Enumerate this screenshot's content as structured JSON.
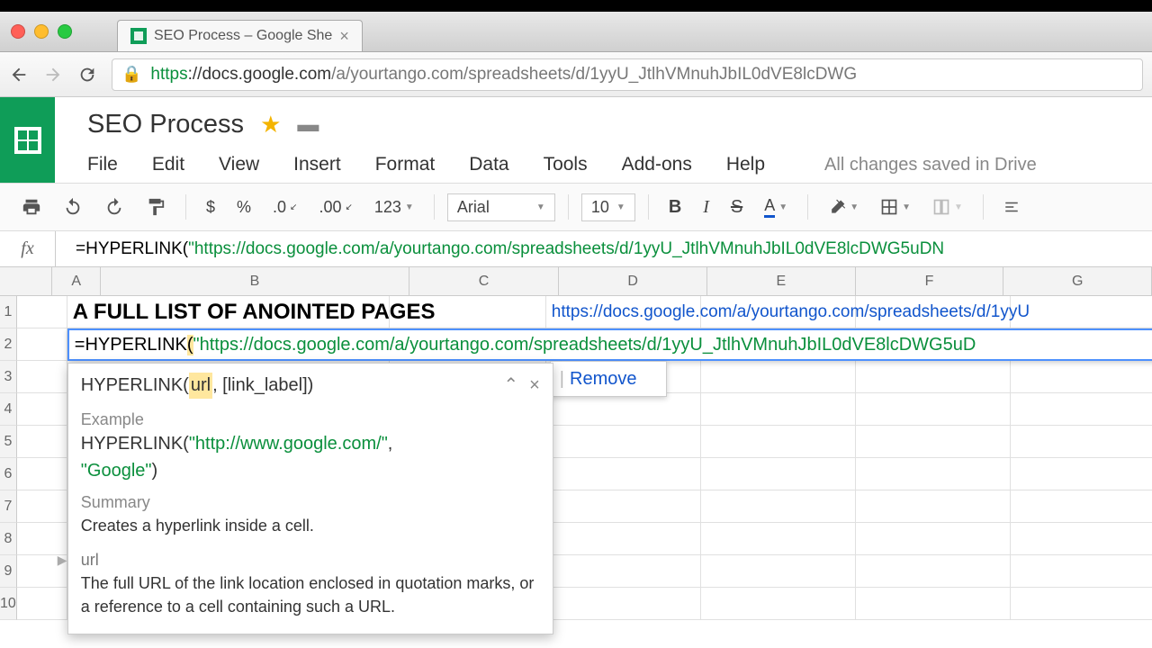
{
  "browser": {
    "tab_title": "SEO Process – Google She",
    "url_protocol": "https",
    "url_host": "://docs.google.com",
    "url_path": "/a/yourtango.com/spreadsheets/d/1yyU_JtlhVMnuhJbIL0dVE8lcDWG"
  },
  "doc": {
    "title": "SEO Process",
    "save_status": "All changes saved in Drive"
  },
  "menus": [
    "File",
    "Edit",
    "View",
    "Insert",
    "Format",
    "Data",
    "Tools",
    "Add-ons",
    "Help"
  ],
  "toolbar": {
    "currency": "$",
    "percent": "%",
    "dec_less": ".0",
    "dec_more": ".00",
    "num_format": "123",
    "font": "Arial",
    "size": "10",
    "bold": "B",
    "italic": "I",
    "strike": "S",
    "text_color": "A"
  },
  "fx": {
    "label": "fx",
    "prefix": "=HYPERLINK(",
    "url": "\"https://docs.google.com/a/yourtango.com/spreadsheets/d/1yyU_JtlhVMnuhJbIL0dVE8lcDWG5uDN"
  },
  "columns": [
    "A",
    "B",
    "C",
    "D",
    "E",
    "F",
    "G"
  ],
  "rows": [
    "1",
    "2",
    "3",
    "4",
    "5",
    "6",
    "7",
    "8",
    "9",
    "10"
  ],
  "cells": {
    "B1": "A FULL LIST OF ANOINTED PAGES",
    "D1": "https://docs.google.com/a/yourtango.com/spreadsheets/d/1yyU"
  },
  "editing": {
    "prefix": "=HYPERLINK",
    "paren": "(",
    "url": "\"https://docs.google.com/a/yourtango.com/spreadsheets/d/1yyU_JtlhVMnuhJbIL0dVE8lcDWG5uD"
  },
  "hint": {
    "sig_fn": "HYPERLINK(",
    "sig_url": "url",
    "sig_rest": ", [link_label])",
    "example_label": "Example",
    "example_fn": "HYPERLINK(",
    "example_url": "\"http://www.google.com/\"",
    "example_mid": ",",
    "example_label2": "\"Google\"",
    "example_close": ")",
    "summary_label": "Summary",
    "summary_text": "Creates a hyperlink inside a cell.",
    "url_label": "url",
    "url_desc": "The full URL of the link location enclosed in quotation marks, or a reference to a cell containing such a URL."
  },
  "link_popup": {
    "remove": "Remove"
  }
}
